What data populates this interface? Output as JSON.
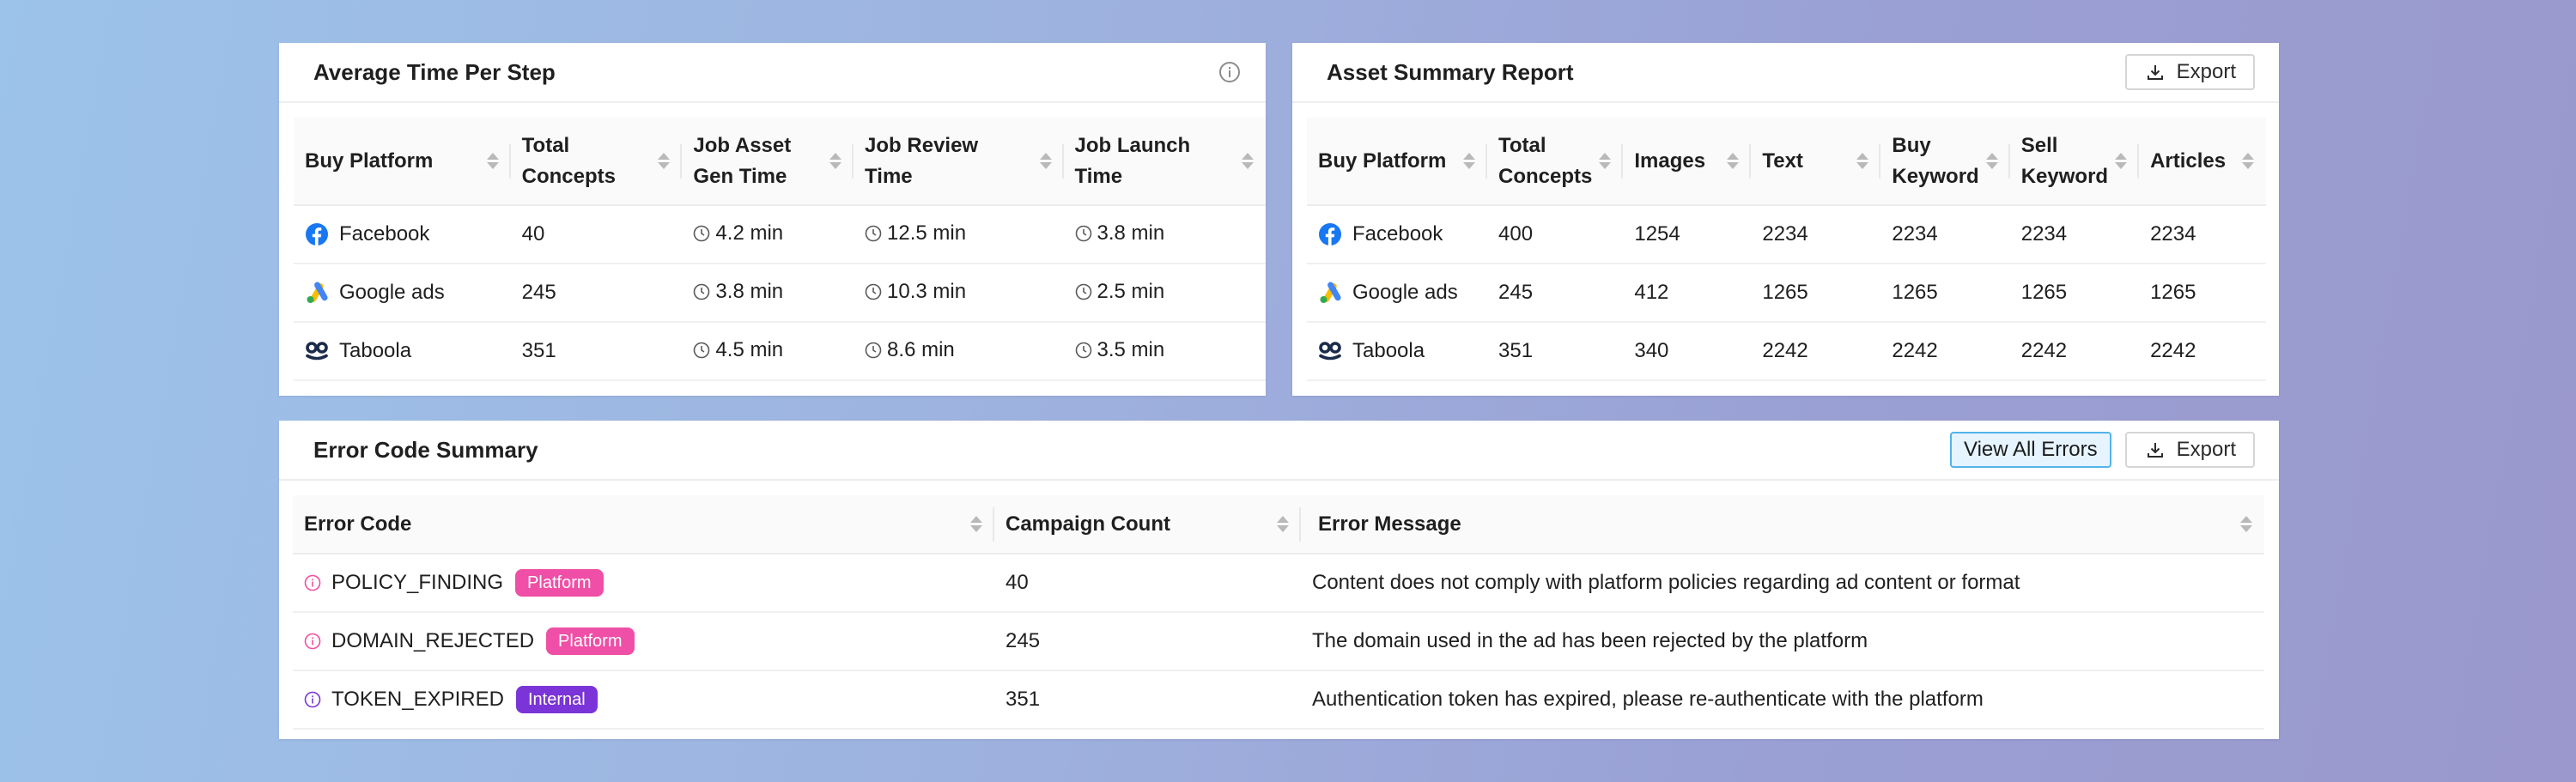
{
  "colors": {
    "platform_badge": "#ef4fa6",
    "internal_badge": "#7b34d8",
    "facebook": "#1877f2",
    "google_blue": "#4285f4",
    "google_yellow": "#fbbc04",
    "google_green": "#34a853",
    "taboola": "#1b2b4a",
    "primary_border": "#52b4ea"
  },
  "avg_time": {
    "title": "Average Time Per Step",
    "info_icon": "info-circle-icon",
    "headers": [
      {
        "l1": "Buy Platform",
        "l2": ""
      },
      {
        "l1": "Total",
        "l2": "Concepts"
      },
      {
        "l1": "Job Asset",
        "l2": "Gen Time"
      },
      {
        "l1": "Job Review",
        "l2": "Time"
      },
      {
        "l1": "Job Launch",
        "l2": "Time"
      }
    ],
    "rows": [
      {
        "platform": "Facebook",
        "total": "40",
        "gen": "4.2 min",
        "review": "12.5 min",
        "launch": "3.8 min"
      },
      {
        "platform": "Google ads",
        "total": "245",
        "gen": "3.8 min",
        "review": "10.3 min",
        "launch": "2.5 min"
      },
      {
        "platform": "Taboola",
        "total": "351",
        "gen": "4.5 min",
        "review": "8.6 min",
        "launch": "3.5 min"
      }
    ]
  },
  "asset_summary": {
    "title": "Asset Summary Report",
    "export_label": "Export",
    "headers": [
      {
        "l1": "Buy Platform",
        "l2": ""
      },
      {
        "l1": "Total",
        "l2": "Concepts"
      },
      {
        "l1": "Images",
        "l2": ""
      },
      {
        "l1": "Text",
        "l2": ""
      },
      {
        "l1": "Buy",
        "l2": "Keyword"
      },
      {
        "l1": "Sell",
        "l2": "Keyword"
      },
      {
        "l1": "Articles",
        "l2": ""
      }
    ],
    "rows": [
      {
        "platform": "Facebook",
        "total": "400",
        "images": "1254",
        "text": "2234",
        "buy": "2234",
        "sell": "2234",
        "articles": "2234"
      },
      {
        "platform": "Google ads",
        "total": "245",
        "images": "412",
        "text": "1265",
        "buy": "1265",
        "sell": "1265",
        "articles": "1265"
      },
      {
        "platform": "Taboola",
        "total": "351",
        "images": "340",
        "text": "2242",
        "buy": "2242",
        "sell": "2242",
        "articles": "2242"
      }
    ]
  },
  "error_summary": {
    "title": "Error Code Summary",
    "view_all_label": "View All Errors",
    "export_label": "Export",
    "headers": [
      "Error Code",
      "Campaign Count",
      "Error Message"
    ],
    "rows": [
      {
        "code": "POLICY_FINDING",
        "badge": "Platform",
        "count": "40",
        "message": "Content does not comply with platform policies regarding ad content or format"
      },
      {
        "code": "DOMAIN_REJECTED",
        "badge": "Platform",
        "count": "245",
        "message": "The domain used in the ad has been rejected by the platform"
      },
      {
        "code": "TOKEN_EXPIRED",
        "badge": "Internal",
        "count": "351",
        "message": "Authentication token has expired, please re-authenticate with the platform"
      }
    ]
  }
}
